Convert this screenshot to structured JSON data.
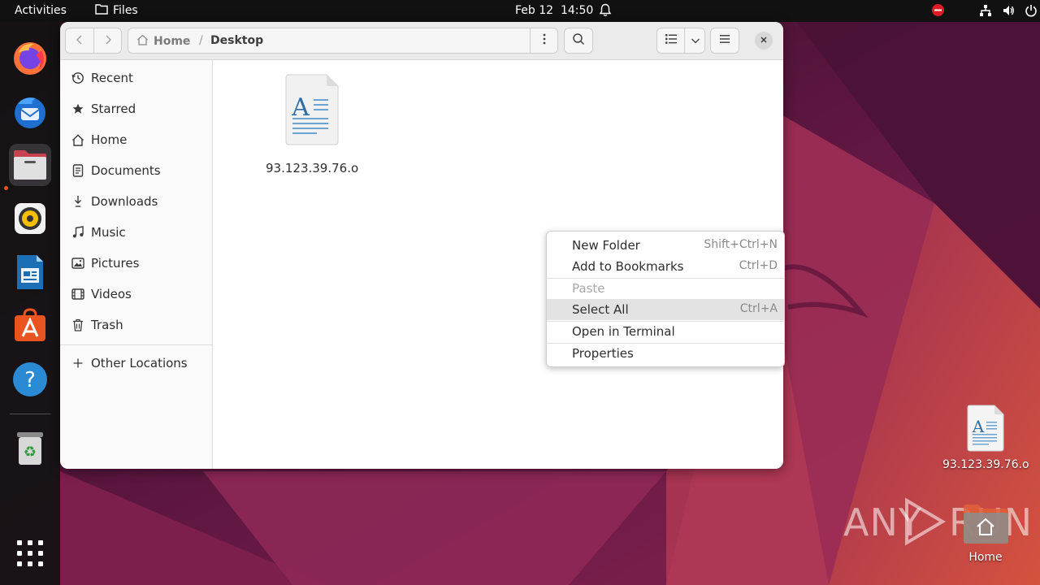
{
  "topbar": {
    "activities": "Activities",
    "app_name": "Files",
    "clock": "Feb 12  14:50"
  },
  "dock": {
    "items": [
      "firefox-icon",
      "thunderbird-icon",
      "files-icon",
      "rhythmbox-icon",
      "libreoffice-writer-icon",
      "app-center-icon",
      "help-icon",
      "trash-icon",
      "show-apps-icon"
    ]
  },
  "window": {
    "path": {
      "home_label": "Home",
      "separator": "/",
      "current": "Desktop"
    },
    "sidebar": {
      "items": [
        {
          "label": "Recent",
          "icon": "clock-icon"
        },
        {
          "label": "Starred",
          "icon": "star-icon"
        },
        {
          "label": "Home",
          "icon": "home-icon"
        },
        {
          "label": "Documents",
          "icon": "document-icon"
        },
        {
          "label": "Downloads",
          "icon": "download-icon"
        },
        {
          "label": "Music",
          "icon": "music-icon"
        },
        {
          "label": "Pictures",
          "icon": "picture-icon"
        },
        {
          "label": "Videos",
          "icon": "video-icon"
        },
        {
          "label": "Trash",
          "icon": "trash-icon"
        }
      ],
      "other_locations": "Other Locations"
    },
    "files": [
      {
        "name": "93.123.39.76.o",
        "icon": "text-document-icon"
      }
    ]
  },
  "context_menu": {
    "items": [
      {
        "label": "New Folder",
        "shortcut": "Shift+Ctrl+N"
      },
      {
        "label": "Add to Bookmarks",
        "shortcut": "Ctrl+D"
      },
      {
        "label": "Paste",
        "shortcut": ""
      },
      {
        "label": "Select All",
        "shortcut": "Ctrl+A"
      },
      {
        "label": "Open in Terminal",
        "shortcut": ""
      },
      {
        "label": "Properties",
        "shortcut": ""
      }
    ]
  },
  "desktop": {
    "file_label": "93.123.39.76.o",
    "home_label": "Home",
    "watermark_left": "ANY",
    "watermark_right": "RUN"
  },
  "colors": {
    "accent": "#e95420",
    "topbar": "#111111",
    "dock": "#1a1a1a"
  }
}
